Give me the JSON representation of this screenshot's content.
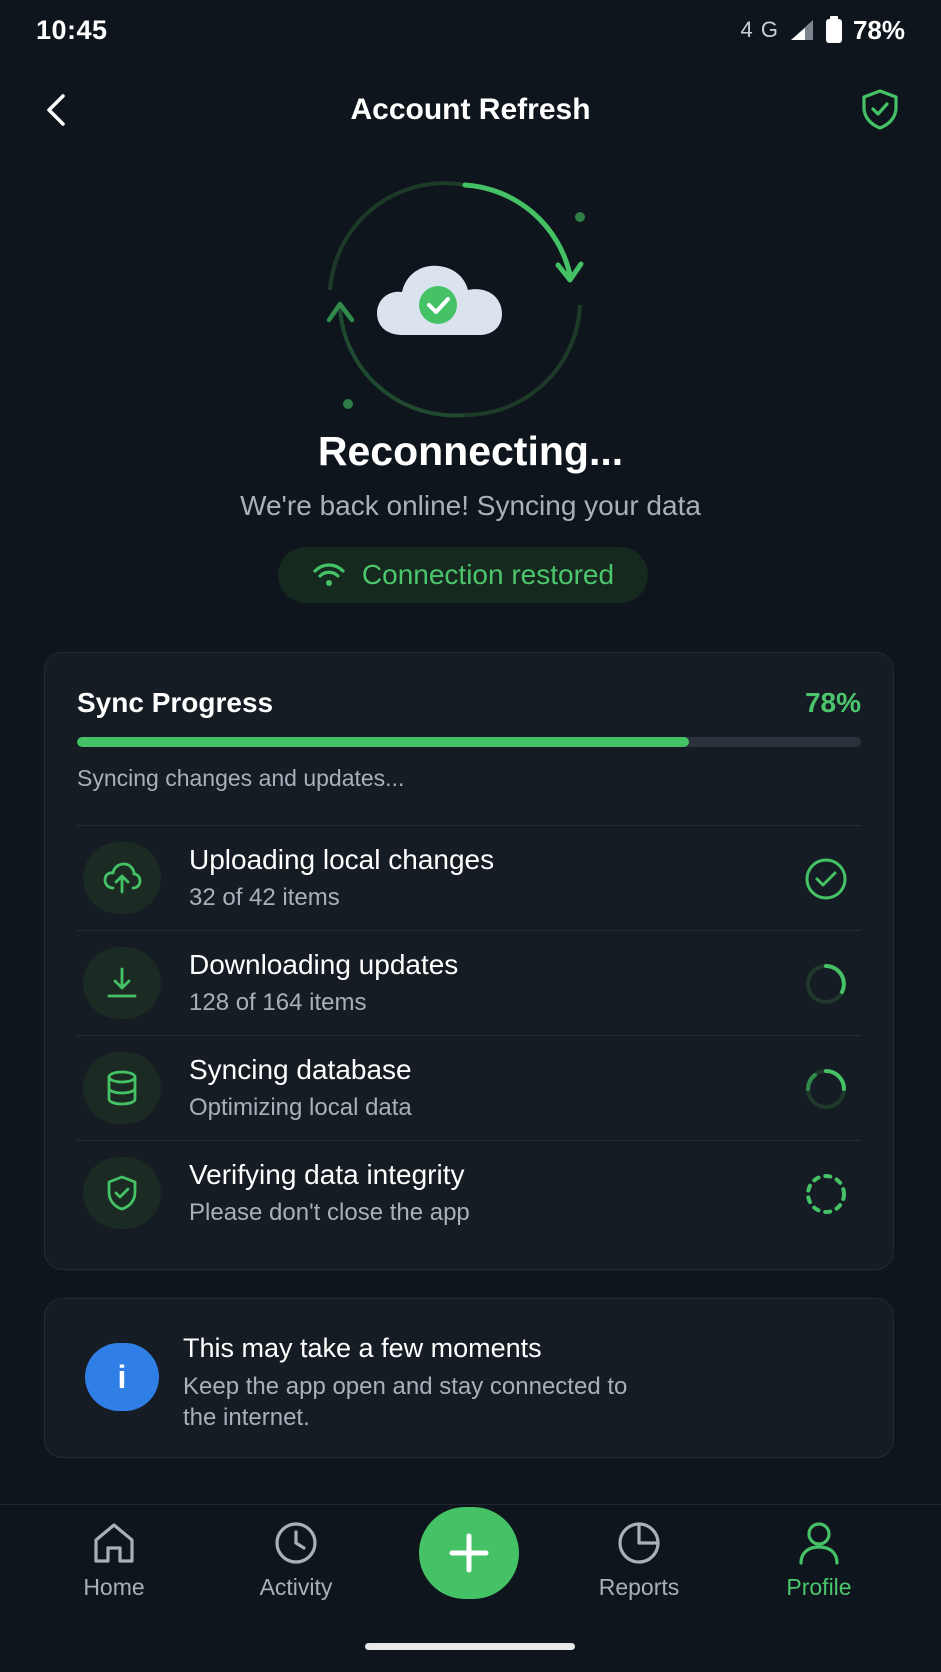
{
  "status_bar": {
    "time": "10:45",
    "network": "4 G",
    "battery": "78%"
  },
  "header": {
    "title": "Account Refresh"
  },
  "hero": {
    "title": "Reconnecting...",
    "subtitle": "We're back online! Syncing your data",
    "connection_status": "Connection restored"
  },
  "sync": {
    "title": "Sync Progress",
    "percent_label": "78%",
    "progress": 0.78,
    "note": "Syncing changes and updates...",
    "tasks": [
      {
        "title": "Uploading local changes",
        "sub": "32 of 42 items",
        "state": "done",
        "icon": "cloud-upload-icon"
      },
      {
        "title": "Downloading updates",
        "sub": "128 of 164 items",
        "state": "in-progress",
        "icon": "download-icon"
      },
      {
        "title": "Syncing database",
        "sub": "Optimizing local data",
        "state": "in-progress",
        "icon": "database-icon"
      },
      {
        "title": "Verifying data integrity",
        "sub": "Please don't close the app",
        "state": "pending",
        "icon": "shield-check-icon"
      }
    ]
  },
  "info": {
    "title": "This may take a few moments",
    "subtitle": "Keep the app open and stay connected to the internet.",
    "icon": "i"
  },
  "nav": {
    "items": [
      {
        "label": "Home",
        "icon": "home-icon"
      },
      {
        "label": "Activity",
        "icon": "clock-icon"
      },
      {
        "label": "Reports",
        "icon": "pie-chart-icon"
      },
      {
        "label": "Profile",
        "icon": "user-icon"
      }
    ],
    "active": "Profile"
  },
  "colors": {
    "accent": "#45c266",
    "info": "#2f7fe6",
    "background": "#0f151c"
  }
}
